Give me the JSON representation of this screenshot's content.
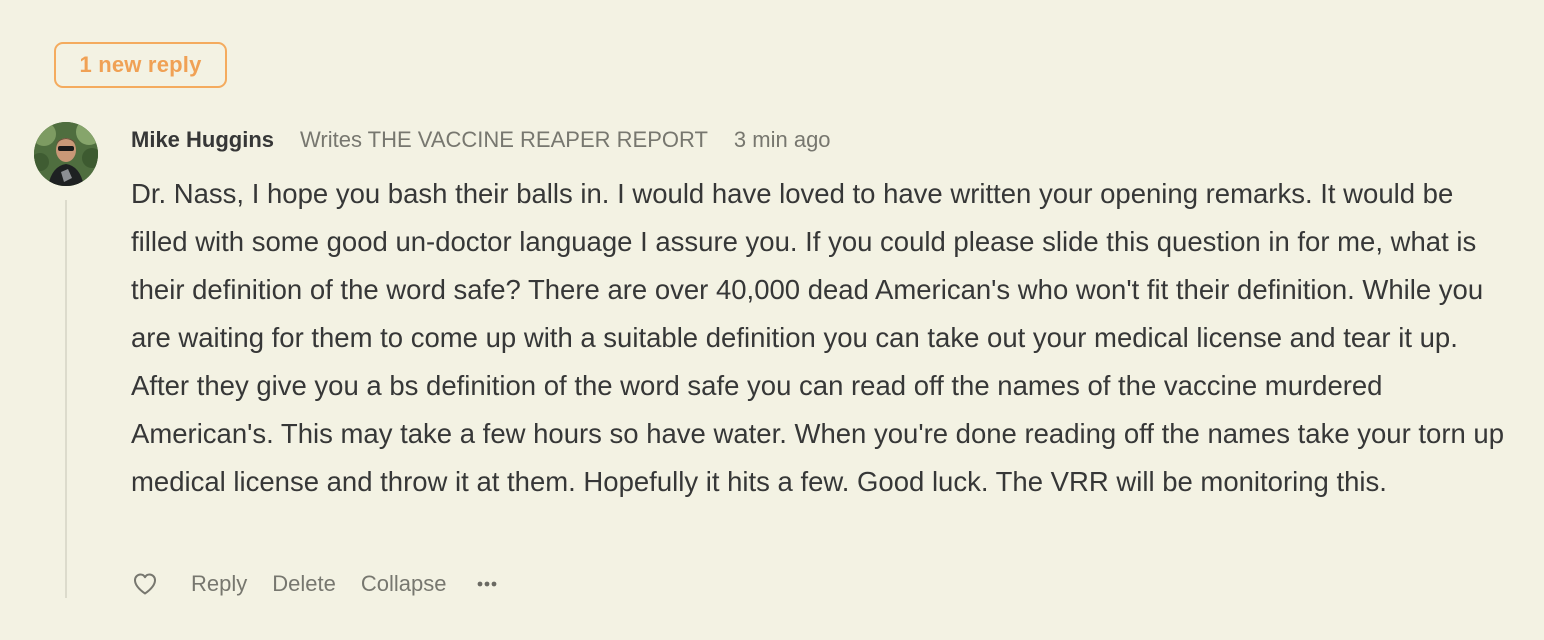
{
  "new_reply_pill": {
    "label": "1 new reply"
  },
  "comment": {
    "author": "Mike Huggins",
    "writes": "Writes THE VACCINE REAPER REPORT",
    "time": "3 min ago",
    "body": "Dr. Nass, I hope you bash their balls in. I would have loved to have written your opening remarks. It would be filled with some good un-doctor language I assure you. If you could please slide this question in for me, what is their definition of the word safe? There are over 40,000 dead American's who won't fit their definition. While you are waiting for them to come up with a suitable definition you can take out your medical license and tear it up. After they give you a bs definition of the word safe you can read off the names of the vaccine murdered American's. This may take a few hours so have water. When you're done reading off the names take your torn up medical license and throw it at them. Hopefully it hits a few. Good luck. The VRR will be monitoring this."
  },
  "actions": {
    "like_icon": "heart-icon",
    "reply": "Reply",
    "delete": "Delete",
    "collapse": "Collapse",
    "more_icon": "ellipsis-icon"
  },
  "colors": {
    "background": "#f3f2e3",
    "accent": "#f4ab5e",
    "text": "#363737",
    "muted": "#77776f"
  }
}
